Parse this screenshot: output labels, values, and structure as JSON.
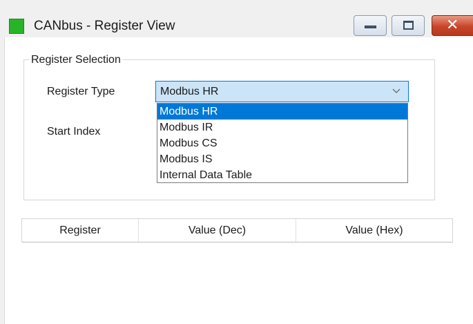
{
  "window": {
    "title": "CANbus - Register View",
    "app_icon_color": "#27b427",
    "controls": {
      "minimize": "minimize",
      "maximize": "maximize",
      "close": "close"
    }
  },
  "register_selection": {
    "group_title": "Register Selection",
    "register_type_label": "Register Type",
    "start_index_label": "Start Index",
    "register_type": {
      "selected_value": "Modbus HR",
      "options": [
        "Modbus HR",
        "Modbus IR",
        "Modbus CS",
        "Modbus IS",
        "Internal Data Table"
      ],
      "highlighted_index": 0
    }
  },
  "table": {
    "columns": [
      "Register",
      "Value (Dec)",
      "Value (Hex)"
    ],
    "rows": []
  },
  "colors": {
    "selection_blue": "#0078d7",
    "combo_focus_bg": "#cce4f7",
    "close_button_red": "#c8452a"
  }
}
